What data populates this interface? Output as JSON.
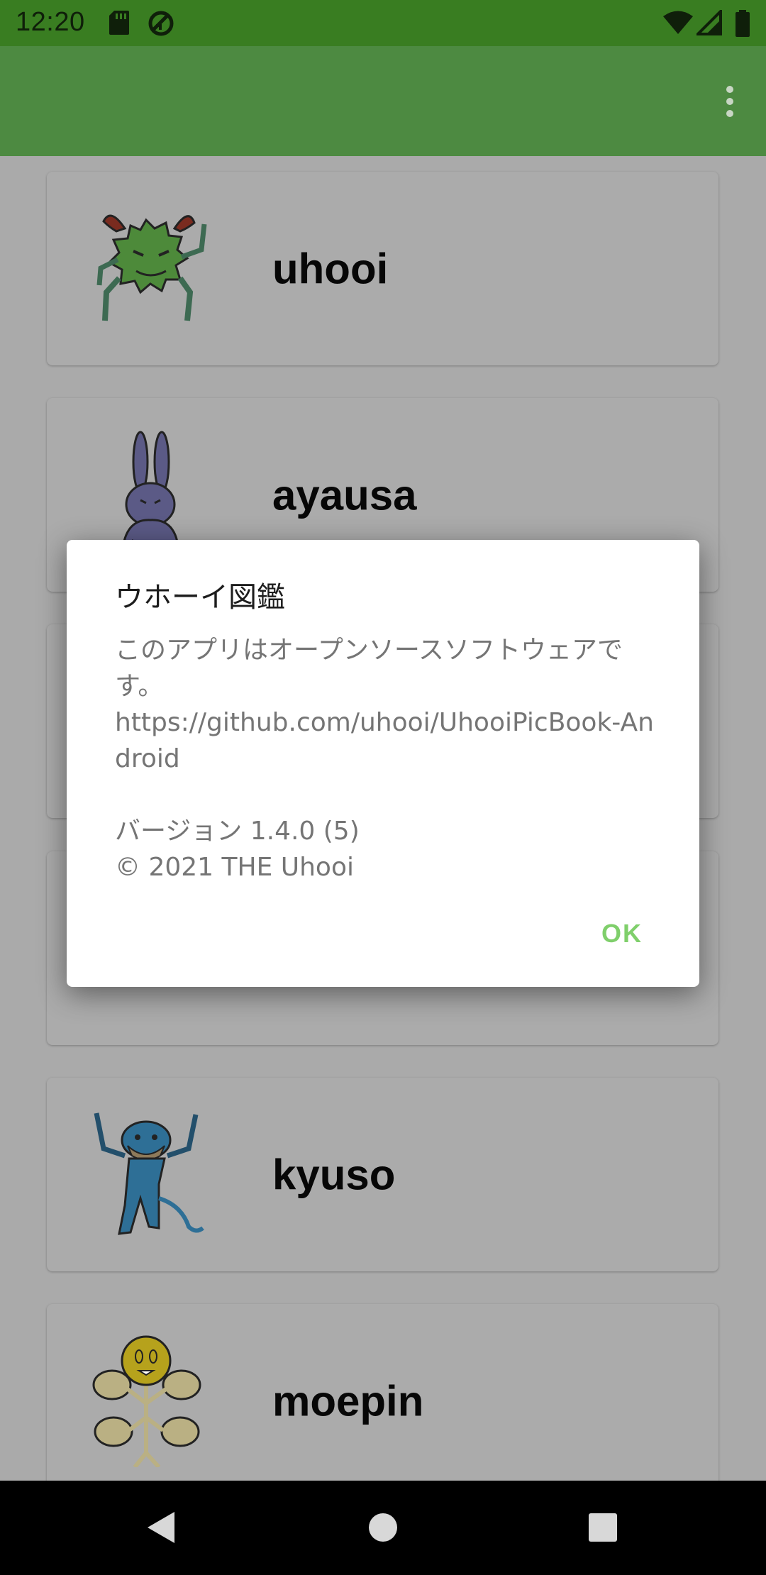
{
  "status_bar": {
    "time": "12:20",
    "icons": [
      "sd-card-icon",
      "data-saver-icon",
      "wifi-icon",
      "signal-icon",
      "battery-icon"
    ]
  },
  "app_bar": {
    "menu_icon": "more-vert-icon"
  },
  "list": {
    "items": [
      {
        "name": "uhooi",
        "image": "green-spiky-monster"
      },
      {
        "name": "ayausa",
        "image": "purple-rabbit"
      },
      {
        "name": "",
        "image": ""
      },
      {
        "name": "",
        "image": ""
      },
      {
        "name": "kyuso",
        "image": "blue-rat"
      },
      {
        "name": "moepin",
        "image": "yellow-flower-creature"
      }
    ]
  },
  "dialog": {
    "title": "ウホーイ図鑑",
    "message": "このアプリはオープンソースソフトウェアです。\nhttps://github.com/uhooi/UhooiPicBook-Android\n\nバージョン 1.4.0 (5)\n© 2021 THE Uhooi",
    "ok_label": "OK"
  },
  "nav_bar": {
    "icons": [
      "back-icon",
      "home-icon",
      "recents-icon"
    ]
  },
  "colors": {
    "status_bar": "#397d21",
    "app_bar": "#4d8a41",
    "scrim_background": "#aaaaaa",
    "accent": "#7fcf6b"
  }
}
